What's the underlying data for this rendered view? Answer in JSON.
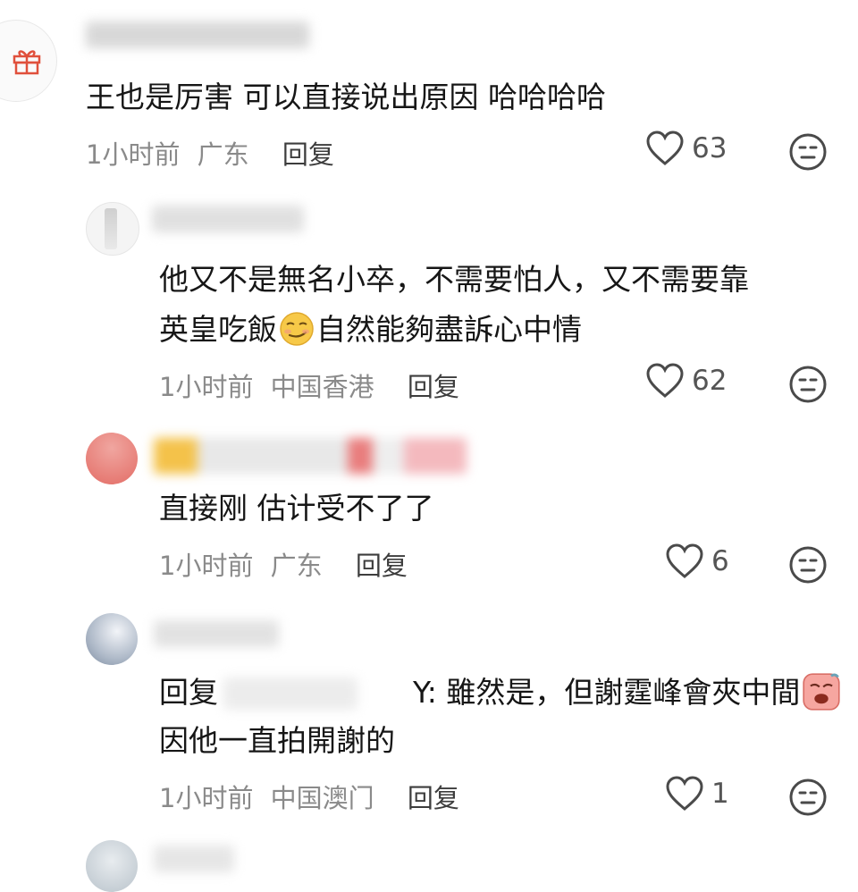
{
  "comments": [
    {
      "text_lines": [
        "王也是厉害 可以直接说出原因 哈哈哈哈"
      ],
      "time": "1小时前",
      "location": "广东",
      "reply_label": "回复",
      "likes": "63"
    },
    {
      "text_before_emoji": "他又不是無名小卒，不需要怕人，又不需要靠",
      "line2_before_emoji": "英皇吃飯",
      "line2_after_emoji": "自然能夠盡訴心中情",
      "time": "1小时前",
      "location": "中国香港",
      "reply_label": "回复",
      "likes": "62"
    },
    {
      "text_lines": [
        "直接刚 估计受不了了"
      ],
      "time": "1小时前",
      "location": "广东",
      "reply_label": "回复",
      "likes": "6"
    },
    {
      "reply_prefix": "回复",
      "reply_suffix": "Y: 雖然是，但謝霆峰會夾中間",
      "line2": "因他一直拍開謝的",
      "time": "1小时前",
      "location": "中国澳门",
      "reply_label": "回复",
      "likes": "1"
    }
  ],
  "icons": {
    "gift": "gift-icon",
    "like": "heart-outline-icon",
    "dislike": "dislike-face-icon",
    "smirk_emoji": "smirk-emoji",
    "crying_emoji": "crying-emoji"
  },
  "colors": {
    "text": "#161616",
    "meta": "#8a8a8a",
    "icon": "#4a4a4a"
  }
}
